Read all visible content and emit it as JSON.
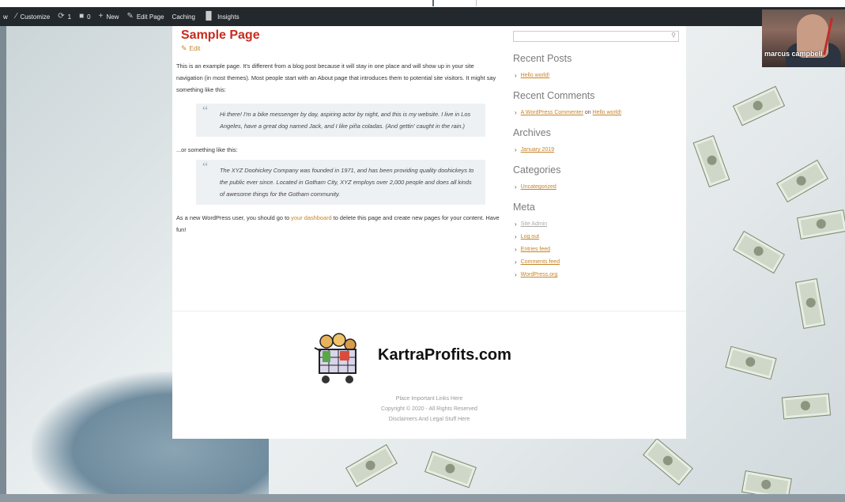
{
  "adminbar": {
    "items": [
      {
        "icon": "wordpress-icon",
        "label": "w"
      },
      {
        "icon": "brush-icon",
        "label": "Customize"
      },
      {
        "icon": "updates-icon",
        "label": "1"
      },
      {
        "icon": "comment-icon",
        "label": "0"
      },
      {
        "icon": "plus-icon",
        "label": "New"
      },
      {
        "icon": "pencil-icon",
        "label": "Edit Page"
      },
      {
        "icon": "",
        "label": "Caching"
      },
      {
        "icon": "bar-chart-icon",
        "label": "Insights"
      }
    ]
  },
  "webcam": {
    "name": "marcus campbell"
  },
  "page": {
    "title": "Sample Page",
    "edit_label": "Edit",
    "intro": "This is an example page. It's different from a blog post because it will stay in one place and will show up in your site navigation (in most themes). Most people start with an About page that introduces them to potential site visitors. It might say something like this:",
    "quote1": "Hi there! I'm a bike messenger by day, aspiring actor by night, and this is my website. I live in Los Angeles, have a great dog named Jack, and I like piña coladas. (And gettin' caught in the rain.)",
    "or_line": "...or something like this:",
    "quote2": "The XYZ Doohickey Company was founded in 1971, and has been providing quality doohickeys to the public ever since. Located in Gotham City, XYZ employs over 2,000 people and does all kinds of awesome things for the Gotham community.",
    "outro_before": "As a new WordPress user, you should go to ",
    "outro_link": "your dashboard",
    "outro_after": " to delete this page and create new pages for your content. Have fun!"
  },
  "sidebar": {
    "recent_posts_title": "Recent Posts",
    "recent_posts": [
      "Hello world!"
    ],
    "recent_comments_title": "Recent Comments",
    "recent_comment": {
      "author": "A WordPress Commenter",
      "on": "on",
      "post": "Hello world!"
    },
    "archives_title": "Archives",
    "archives": [
      "January 2019"
    ],
    "categories_title": "Categories",
    "categories": [
      "Uncategorized"
    ],
    "meta_title": "Meta",
    "meta": [
      "Site Admin",
      "Log out",
      "Entries feed",
      "Comments feed",
      "WordPress.org"
    ]
  },
  "footer": {
    "brand": "KartraProfits.com",
    "lines": [
      "Place Important Links Here",
      "Copyright © 2020 - All Rights Reserved",
      "Disclaimers And Legal Stuff Here"
    ]
  },
  "colors": {
    "title": "#c62b1e",
    "link": "#c8832a",
    "adminbar": "#23282d"
  }
}
